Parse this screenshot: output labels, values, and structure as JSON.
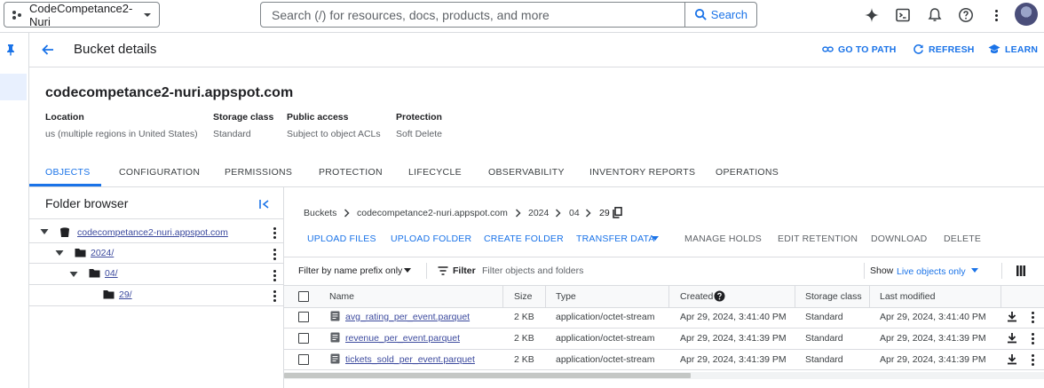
{
  "topbar": {
    "project": "CodeCompetance2-Nuri",
    "search_placeholder": "Search (/) for resources, docs, products, and more",
    "search_button": "Search"
  },
  "header": {
    "title": "Bucket details",
    "go_to_path": "GO TO PATH",
    "refresh": "REFRESH",
    "learn": "LEARN"
  },
  "bucket": {
    "name": "codecompetance2-nuri.appspot.com",
    "meta": [
      {
        "label": "Location",
        "value": "us (multiple regions in United States)"
      },
      {
        "label": "Storage class",
        "value": "Standard"
      },
      {
        "label": "Public access",
        "value": "Subject to object ACLs"
      },
      {
        "label": "Protection",
        "value": "Soft Delete"
      }
    ]
  },
  "tabs": [
    "OBJECTS",
    "CONFIGURATION",
    "PERMISSIONS",
    "PROTECTION",
    "LIFECYCLE",
    "OBSERVABILITY",
    "INVENTORY REPORTS",
    "OPERATIONS"
  ],
  "folder_browser": {
    "title": "Folder browser",
    "tree": [
      "codecompetance2-nuri.appspot.com",
      "2024/",
      "04/",
      "29/"
    ]
  },
  "breadcrumb": [
    "Buckets",
    "codecompetance2-nuri.appspot.com",
    "2024",
    "04",
    "29"
  ],
  "actions": {
    "upload_files": "UPLOAD FILES",
    "upload_folder": "UPLOAD FOLDER",
    "create_folder": "CREATE FOLDER",
    "transfer_data": "TRANSFER DATA",
    "manage_holds": "MANAGE HOLDS",
    "edit_retention": "EDIT RETENTION",
    "download": "DOWNLOAD",
    "delete": "DELETE"
  },
  "filterbar": {
    "prefix": "Filter by name prefix only",
    "filter_label": "Filter",
    "filter_placeholder": "Filter objects and folders",
    "show_label": "Show",
    "show_value": "Live objects only"
  },
  "table": {
    "columns": [
      "Name",
      "Size",
      "Type",
      "Created",
      "Storage class",
      "Last modified"
    ],
    "rows": [
      {
        "name": "avg_rating_per_event.parquet",
        "size": "2 KB",
        "type": "application/octet-stream",
        "created": "Apr 29, 2024, 3:41:40 PM",
        "storage": "Standard",
        "modified": "Apr 29, 2024, 3:41:40 PM"
      },
      {
        "name": "revenue_per_event.parquet",
        "size": "2 KB",
        "type": "application/octet-stream",
        "created": "Apr 29, 2024, 3:41:39 PM",
        "storage": "Standard",
        "modified": "Apr 29, 2024, 3:41:39 PM"
      },
      {
        "name": "tickets_sold_per_event.parquet",
        "size": "2 KB",
        "type": "application/octet-stream",
        "created": "Apr 29, 2024, 3:41:39 PM",
        "storage": "Standard",
        "modified": "Apr 29, 2024, 3:41:39 PM"
      }
    ]
  },
  "colors": {
    "accent": "#1a73e8",
    "link": "#3c4a9e",
    "border": "#dadce0"
  }
}
